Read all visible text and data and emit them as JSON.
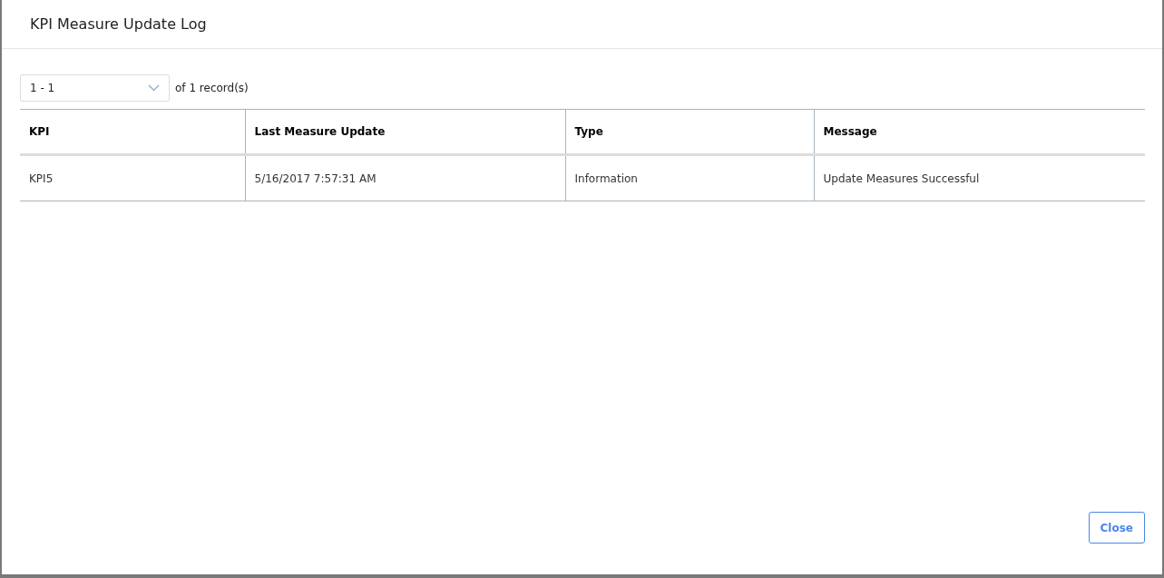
{
  "dialog": {
    "title": "KPI Measure Update Log"
  },
  "pager": {
    "range": "1 - 1",
    "summary": "of 1 record(s)"
  },
  "table": {
    "columns": [
      "KPI",
      "Last Measure Update",
      "Type",
      "Message"
    ],
    "rows": [
      [
        "KPI5",
        "5/16/2017 7:57:31 AM",
        "Information",
        "Update Measures Successful"
      ]
    ]
  },
  "buttons": [
    "Close"
  ]
}
